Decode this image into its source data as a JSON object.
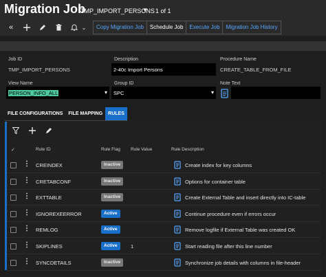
{
  "header": {
    "title": "Migration Job",
    "record": "TMP_IMPORT_PERSONS",
    "record_count": "1 of 1"
  },
  "toolbar": {
    "buttons": [
      "Copy Migration Job",
      "Schedule Job",
      "Execute Job",
      "Migration Job History"
    ]
  },
  "form": {
    "job_id_label": "Job ID",
    "job_id_value": "TMP_IMPORT_PERSONS",
    "description_label": "Description",
    "description_value": "2-40c Import Persons",
    "procedure_label": "Procedure Name",
    "procedure_value": "CREATE_TABLE_FROM_FILE",
    "view_label": "View Name",
    "view_value": "PERSON_INFO_ALL",
    "group_label": "Group ID",
    "group_value": "SPC",
    "note_label": "Note Text"
  },
  "tabs": [
    "FILE CONFIGURATIONS",
    "FILE MAPPING",
    "RULES"
  ],
  "grid": {
    "columns": [
      "Rule ID",
      "Rule Flag",
      "Rule Value",
      "Rule Description"
    ],
    "rows": [
      {
        "rule_id": "CREINDEX",
        "flag": "Inactive",
        "value": "",
        "description": "Create index for key columns"
      },
      {
        "rule_id": "CRETABCONF",
        "flag": "Inactive",
        "value": "",
        "description": "Options for container table"
      },
      {
        "rule_id": "EXTTABLE",
        "flag": "Inactive",
        "value": "",
        "description": "Create External Table and insert directly into IC-table"
      },
      {
        "rule_id": "IGNOREXEERROR",
        "flag": "Active",
        "value": "",
        "description": "Continue procedure even if errors occur"
      },
      {
        "rule_id": "REMLOG",
        "flag": "Active",
        "value": "",
        "description": "Remove logfile if External Table was created OK"
      },
      {
        "rule_id": "SKIPLINES",
        "flag": "Active",
        "value": "1",
        "description": "Start reading file after this line number"
      },
      {
        "rule_id": "SYNCDETAILS",
        "flag": "Inactive",
        "value": "",
        "description": "Synchronize job details with columns in file-header"
      }
    ]
  },
  "colors": {
    "accent": "#1a6fc8",
    "link": "#56a8ff",
    "highlight": "#4ec9a0",
    "inactive_badge": "#777777"
  }
}
